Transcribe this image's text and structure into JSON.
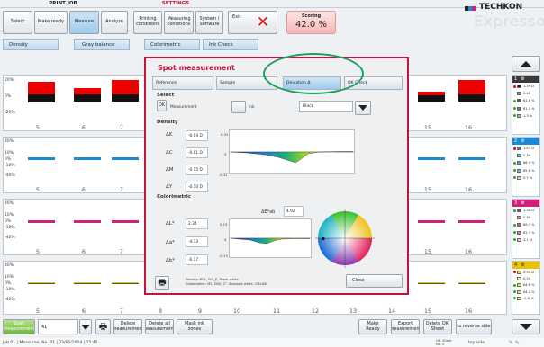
{
  "header": {
    "print_job_label": "PRINT JOB",
    "settings_label": "SETTINGS",
    "print_job_buttons": [
      "Select",
      "Make ready",
      "Measure",
      "Analyze"
    ],
    "settings_buttons": [
      "Printing conditions",
      "Measuring conditions",
      "System / Software"
    ],
    "exit_label": "Exit",
    "scoring_label": "Scoring",
    "scoring_value": "42.0 %",
    "brand": "TECHKON",
    "product": "Expresso"
  },
  "subtabs": [
    "Density",
    "Gray balance",
    "Colorimetric",
    "Ink Check"
  ],
  "columns": [
    "5",
    "6",
    "7",
    "8",
    "9",
    "10",
    "11",
    "12",
    "13",
    "14",
    "15",
    "16"
  ],
  "panel_labels": [
    [
      "20%",
      "0%",
      "-20%"
    ],
    [
      "40%",
      "10%",
      "0%",
      "-10%",
      "-40%"
    ],
    [
      "40%",
      "10%",
      "0%",
      "-10%",
      "-40%"
    ],
    [
      "40%",
      "10%",
      "0%",
      "-10%",
      "-40%"
    ]
  ],
  "right_panels": [
    {
      "index": "1",
      "color": "#222222",
      "rows": [
        "1.39 D",
        "0.46",
        "61.6 %",
        "61.2 %",
        "1.3 %"
      ]
    },
    {
      "index": "2",
      "color": "#1a8ad4",
      "rows": [
        "1.47 D",
        "0.39",
        "66.3 %",
        "65.6 %",
        "0.7 %"
      ]
    },
    {
      "index": "3",
      "color": "#d0207a",
      "rows": [
        "1.30 D",
        "0.30",
        "69.7 %",
        "62.7 %",
        "3.1 %"
      ]
    },
    {
      "index": "4",
      "color": "#f0d41a",
      "rows": [
        "0.92 D",
        "0.20",
        "64.6 %",
        "64.2 %",
        "-0.2 %"
      ]
    }
  ],
  "bottom": {
    "start_label": "Start measurement",
    "sheet_number": "41",
    "delete_label": "Delete measurement",
    "delete_all_label": "Delete all measurements",
    "mask_label": "Mask ink zones",
    "make_ready_label": "Make Ready",
    "export_label": "Export measurement",
    "delete_ok_label": "Delete OK-Sheet",
    "reverse_label": "to reverse side"
  },
  "status": {
    "text": "Job 01 | Measuren. No. 41 | 03/05/2024 | 15:45",
    "ok_sheet": "OK- Sheet No. 0",
    "side": "top side"
  },
  "modal": {
    "title": "Spot measurement",
    "tabs": [
      "Reference",
      "Sample",
      "Deviation Δ",
      "OK Check"
    ],
    "select_label": "Select",
    "ok_button": "OK",
    "measurement_label": "Measurement",
    "ink_label": "Ink",
    "ink_value": "Black",
    "density_label": "Density",
    "density_rows": [
      {
        "label": "ΔK",
        "value": "-0.04 D"
      },
      {
        "label": "ΔC",
        "value": "-0.01 D"
      },
      {
        "label": "ΔM",
        "value": "-0.15 D"
      },
      {
        "label": "ΔY",
        "value": "-0.10 D"
      }
    ],
    "density_ticks": [
      "0.31",
      "0",
      "-0.31"
    ],
    "colorimetric_label": "Colorimetric",
    "de_label": "ΔE*ab",
    "de_value": "4.92",
    "color_rows": [
      {
        "label": "ΔL*",
        "value": "2.34"
      },
      {
        "label": "Δa*",
        "value": "-4.33"
      },
      {
        "label": "Δb*",
        "value": "-0.17"
      }
    ],
    "color_ticks": [
      "0.13",
      "0",
      "-0.13"
    ],
    "info_line1": "Density: POL, ISO_E, Paper white",
    "info_line2": "Colorimetric: M1, D50, 2°, Absolute white, CIELAB",
    "close_label": "Close"
  }
}
